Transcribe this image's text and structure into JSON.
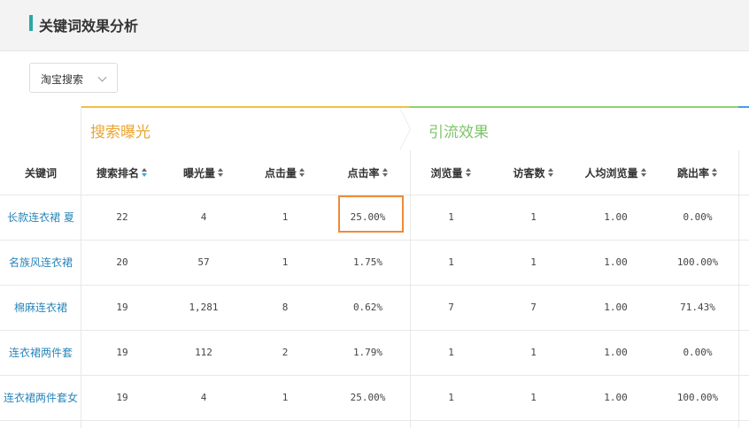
{
  "header": {
    "title": "关键词效果分析"
  },
  "filter": {
    "selected": "淘宝搜索"
  },
  "groups": {
    "search": "搜索曝光",
    "traffic": "引流效果"
  },
  "columns": {
    "keyword": "关键词",
    "rank": "搜索排名",
    "exposure": "曝光量",
    "clicks": "点击量",
    "ctr": "点击率",
    "views": "浏览量",
    "visitors": "访客数",
    "avg_views": "人均浏览量",
    "bounce": "跳出率"
  },
  "rows": [
    {
      "keyword": "长款连衣裙 夏",
      "rank": "22",
      "exposure": "4",
      "clicks": "1",
      "ctr": "25.00%",
      "views": "1",
      "visitors": "1",
      "avg_views": "1.00",
      "bounce": "0.00%"
    },
    {
      "keyword": "名族风连衣裙",
      "rank": "20",
      "exposure": "57",
      "clicks": "1",
      "ctr": "1.75%",
      "views": "1",
      "visitors": "1",
      "avg_views": "1.00",
      "bounce": "100.00%"
    },
    {
      "keyword": "棉麻连衣裙",
      "rank": "19",
      "exposure": "1,281",
      "clicks": "8",
      "ctr": "0.62%",
      "views": "7",
      "visitors": "7",
      "avg_views": "1.00",
      "bounce": "71.43%"
    },
    {
      "keyword": "连衣裙两件套",
      "rank": "19",
      "exposure": "112",
      "clicks": "2",
      "ctr": "1.79%",
      "views": "1",
      "visitors": "1",
      "avg_views": "1.00",
      "bounce": "0.00%"
    },
    {
      "keyword": "连衣裙两件套女",
      "rank": "19",
      "exposure": "4",
      "clicks": "1",
      "ctr": "25.00%",
      "views": "1",
      "visitors": "1",
      "avg_views": "1.00",
      "bounce": "100.00%"
    }
  ],
  "colors": {
    "accent": "#27a9a6",
    "search_group": "#e8a636",
    "traffic_group": "#7cc46a",
    "link": "#2a86bb",
    "highlight": "#ee8a3a"
  }
}
